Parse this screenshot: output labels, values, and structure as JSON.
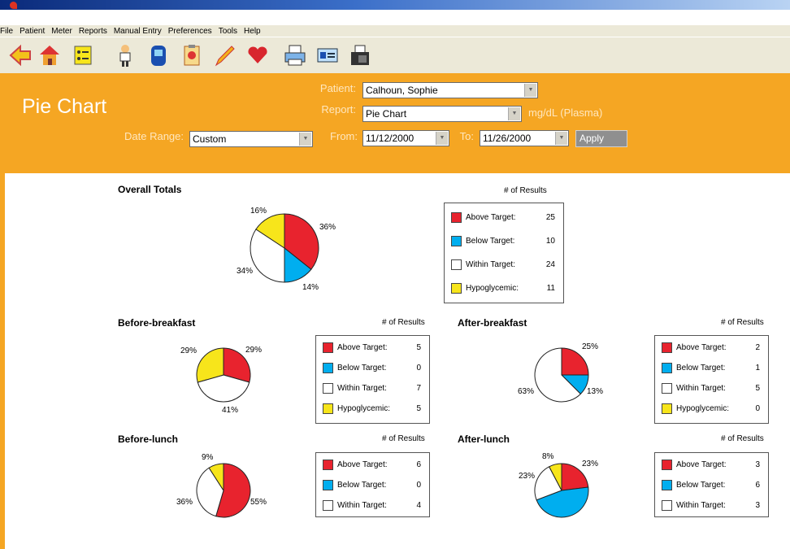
{
  "menu": [
    "File",
    "Patient",
    "Meter",
    "Reports",
    "Manual Entry",
    "Preferences",
    "Tools",
    "Help"
  ],
  "toolbar": [
    "back-icon",
    "home-icon",
    "list-icon",
    "person-icon",
    "meter-icon",
    "clipboard-icon",
    "pencil-icon",
    "heart-icon",
    "printer-icon",
    "card-icon",
    "fax-icon"
  ],
  "header": {
    "title": "Pie Chart",
    "patient_label": "Patient:",
    "patient_value": "Calhoun, Sophie",
    "report_label": "Report:",
    "report_value": "Pie Chart",
    "unit": "mg/dL (Plasma)",
    "date_range_label": "Date Range:",
    "date_range_value": "Custom",
    "from_label": "From:",
    "from_value": "11/12/2000",
    "to_label": "To:",
    "to_value": "11/26/2000",
    "apply": "Apply"
  },
  "colors": {
    "above": "#e8232e",
    "below": "#00aeef",
    "within": "#ffffff",
    "hypo": "#f7e51b",
    "orange": "#f5a623"
  },
  "nres_label": "# of Results",
  "legend_labels": [
    "Above Target:",
    "Below Target:",
    "Within Target:",
    "Hypoglycemic:"
  ],
  "chart_data": [
    {
      "type": "pie",
      "title": "Overall Totals",
      "categories": [
        "Above Target",
        "Below Target",
        "Within Target",
        "Hypoglycemic"
      ],
      "values": [
        25,
        10,
        24,
        11
      ],
      "percent_labels": [
        "36%",
        "14%",
        "34%",
        "16%"
      ]
    },
    {
      "type": "pie",
      "title": "Before-breakfast",
      "categories": [
        "Above Target",
        "Below Target",
        "Within Target",
        "Hypoglycemic"
      ],
      "values": [
        5,
        0,
        7,
        5
      ],
      "percent_labels": [
        "29%",
        "",
        "41%",
        "29%"
      ]
    },
    {
      "type": "pie",
      "title": "After-breakfast",
      "categories": [
        "Above Target",
        "Below Target",
        "Within Target",
        "Hypoglycemic"
      ],
      "values": [
        2,
        1,
        5,
        0
      ],
      "percent_labels": [
        "25%",
        "13%",
        "63%",
        ""
      ]
    },
    {
      "type": "pie",
      "title": "Before-lunch",
      "categories": [
        "Above Target",
        "Below Target",
        "Within Target",
        "Hypoglycemic"
      ],
      "values": [
        6,
        0,
        4,
        1
      ],
      "percent_labels": [
        "55%",
        "",
        "36%",
        "9%"
      ]
    },
    {
      "type": "pie",
      "title": "After-lunch",
      "categories": [
        "Above Target",
        "Below Target",
        "Within Target",
        "Hypoglycemic"
      ],
      "values": [
        3,
        6,
        3,
        1
      ],
      "percent_labels": [
        "23%",
        "",
        "23%",
        "8%"
      ]
    }
  ]
}
